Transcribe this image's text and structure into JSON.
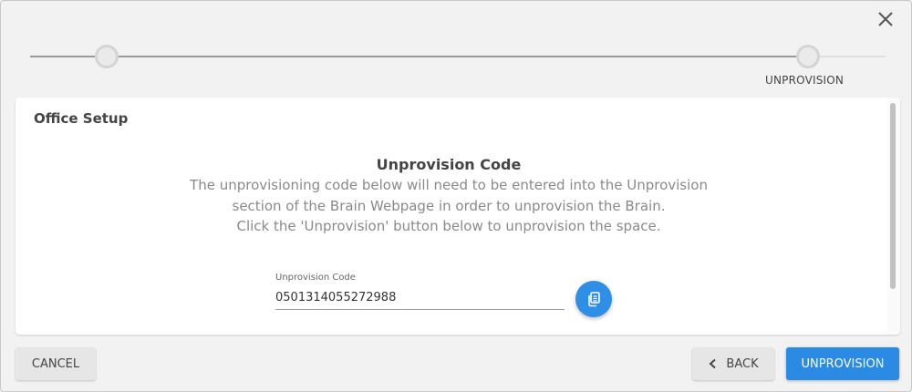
{
  "dialog": {
    "close_icon": "close-icon"
  },
  "stepper": {
    "steps": [
      {
        "label": ""
      },
      {
        "label": "UNPROVISION"
      }
    ]
  },
  "card": {
    "title": "Office Setup",
    "heading": "Unprovision Code",
    "description_lines": [
      "The unprovisioning code below will need to be entered into the Unprovision",
      "section of the Brain Webpage in order to unprovision the Brain.",
      "Click the 'Unprovision' button below to unprovision the space."
    ],
    "code_field": {
      "label": "Unprovision Code",
      "value": "0501314055272988"
    },
    "copy_button_icon": "copy-icon"
  },
  "footer": {
    "cancel_label": "CANCEL",
    "back_label": "BACK",
    "unprovision_label": "UNPROVISION"
  },
  "colors": {
    "primary": "#2a8ae4",
    "background": "#f2f2f2"
  }
}
